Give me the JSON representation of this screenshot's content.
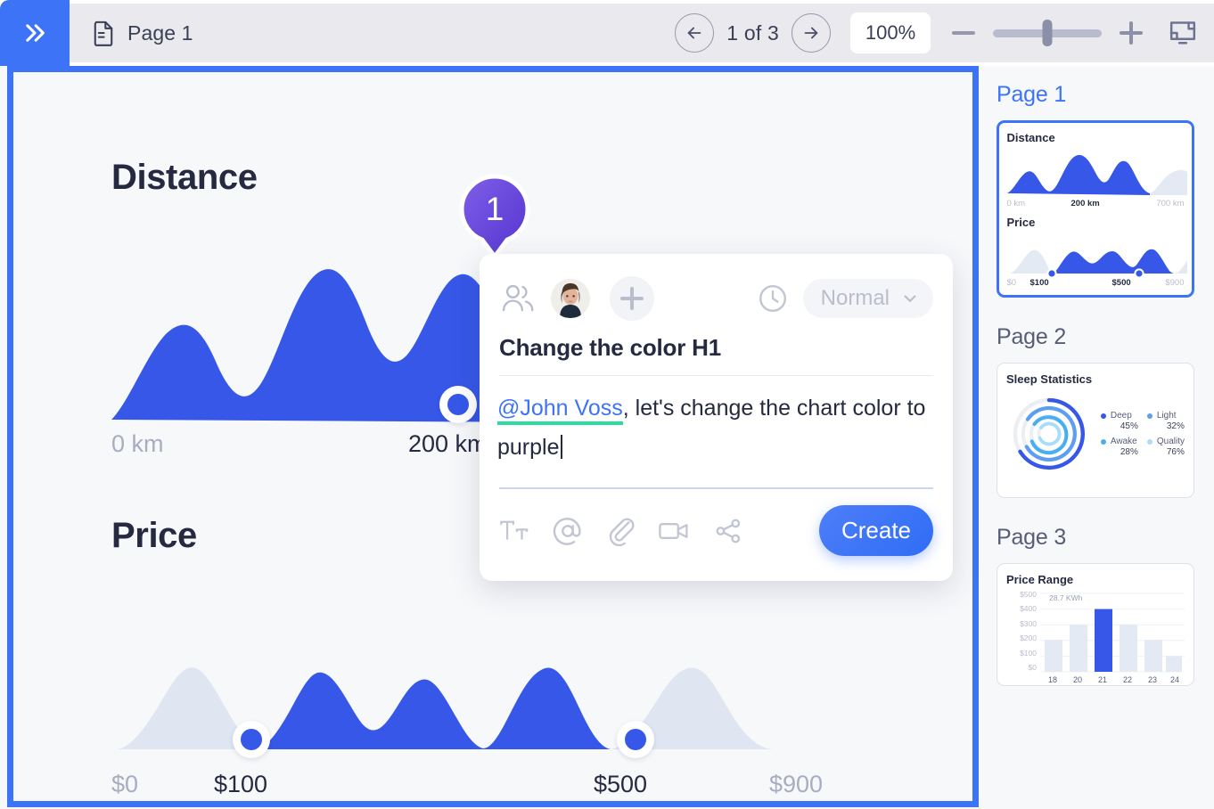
{
  "topbar": {
    "expand_icon": "double-chevron-right-icon",
    "doc_icon": "document-icon",
    "tab_title": "Page 1",
    "prev_icon": "arrow-left-icon",
    "next_icon": "arrow-right-icon",
    "page_count": "1 of 3",
    "zoom_value": "100%",
    "zoom_out_icon": "minus-icon",
    "zoom_in_icon": "plus-icon",
    "present_icon": "present-screen-icon",
    "slider_percent": 50
  },
  "canvas": {
    "pin": {
      "number": "1",
      "color_start": "#7a5ae6",
      "color_end": "#5b3fd6"
    },
    "charts": [
      {
        "title": "Distance",
        "ticks": [
          {
            "label": "0 km",
            "active": false
          },
          {
            "label": "200 km",
            "active": true
          }
        ]
      },
      {
        "title": "Price",
        "ticks": [
          {
            "label": "$0",
            "active": false
          },
          {
            "label": "$100",
            "active": true
          },
          {
            "label": "$500",
            "active": true
          },
          {
            "label": "$900",
            "active": false
          }
        ]
      }
    ]
  },
  "comment_card": {
    "people_icon": "people-icon",
    "avatar_name": "avatar",
    "add_icon": "add-person-icon",
    "clock_icon": "clock-icon",
    "priority_value": "Normal",
    "priority_chevron": "chevron-down-icon",
    "title": "Change the color H1",
    "body_mention": "@John Voss",
    "body_rest": ", let's change the chart color to purple",
    "tools": [
      {
        "icon": "text-format-icon"
      },
      {
        "icon": "mention-at-icon"
      },
      {
        "icon": "attachment-paperclip-icon"
      },
      {
        "icon": "video-camera-icon"
      },
      {
        "icon": "share-icon"
      }
    ],
    "submit_label": "Create",
    "accent_color": "#3d74f7",
    "mention_underline_color": "#2bdca0"
  },
  "sidebar": {
    "pages": [
      {
        "label": "Page 1",
        "selected": true
      },
      {
        "label": "Page 2",
        "selected": false
      },
      {
        "label": "Page 3",
        "selected": false
      }
    ],
    "thumb1": {
      "chart_a_title": "Distance",
      "chart_a_ticks": [
        "0 km",
        "200 km",
        "700 km"
      ],
      "chart_b_title": "Price",
      "chart_b_ticks": [
        "$0",
        "$100",
        "$500",
        "$900"
      ]
    },
    "thumb2": {
      "title": "Sleep Statistics",
      "legend": [
        {
          "name": "Deep",
          "value": "45%",
          "color": "#3657e8"
        },
        {
          "name": "Light",
          "value": "32%",
          "color": "#5c9ef0"
        },
        {
          "name": "Awake",
          "value": "28%",
          "color": "#48aef0"
        },
        {
          "name": "Quality",
          "value": "76%",
          "color": "#a9dcf8"
        }
      ]
    },
    "thumb3": {
      "title": "Price Range",
      "annotation": "28.7 KWh",
      "y_ticks": [
        "$500",
        "$400",
        "$300",
        "$200",
        "$100",
        "$0"
      ],
      "x_ticks": [
        "18",
        "20",
        "21",
        "22",
        "23",
        "24"
      ]
    }
  },
  "chart_data": [
    {
      "type": "area",
      "title": "Distance",
      "xlabel": "",
      "ylabel": "",
      "xticks": [
        "0 km",
        "200 km",
        "700 km"
      ],
      "selection": {
        "from": "0 km",
        "to": "200 km"
      },
      "x": [
        0,
        40,
        80,
        120,
        160,
        200,
        240,
        280,
        320,
        360,
        400,
        440,
        480,
        520,
        560,
        600,
        640,
        700
      ],
      "values": [
        10,
        38,
        60,
        32,
        22,
        68,
        92,
        70,
        52,
        58,
        84,
        78,
        46,
        12,
        48,
        62,
        40,
        22
      ]
    },
    {
      "type": "area",
      "title": "Price",
      "xlabel": "",
      "ylabel": "",
      "xticks": [
        "$0",
        "$100",
        "$500",
        "$900"
      ],
      "selection": {
        "from": "$100",
        "to": "$500"
      },
      "x": [
        0,
        60,
        120,
        180,
        240,
        300,
        360,
        420,
        480,
        540,
        600,
        660,
        720,
        780,
        840,
        900
      ],
      "values": [
        6,
        36,
        58,
        20,
        12,
        72,
        58,
        40,
        56,
        62,
        34,
        80,
        58,
        20,
        46,
        10
      ]
    },
    {
      "type": "pie",
      "title": "Sleep Statistics",
      "labels": [
        "Deep",
        "Light",
        "Awake",
        "Quality"
      ],
      "values": [
        45,
        32,
        28,
        76
      ],
      "legend_position": "right"
    },
    {
      "type": "bar",
      "title": "Price Range",
      "categories": [
        "18",
        "20",
        "21",
        "22",
        "23",
        "24"
      ],
      "values": [
        205,
        300,
        400,
        300,
        205,
        105
      ],
      "highlight_index": 2,
      "annotation": "28.7 KWh",
      "ylabel": "",
      "xlabel": "",
      "ylim": [
        0,
        500
      ],
      "yticks": [
        0,
        100,
        200,
        300,
        400,
        500
      ],
      "grid": true
    }
  ]
}
